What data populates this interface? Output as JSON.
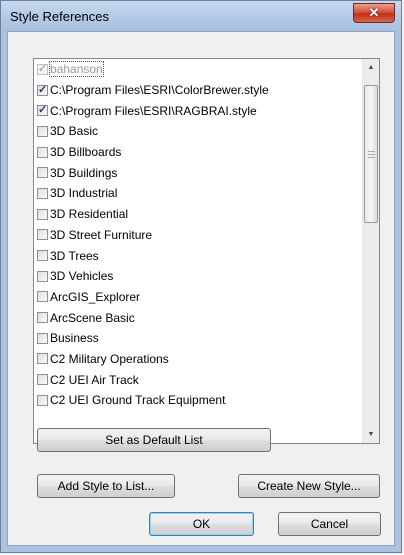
{
  "window": {
    "title": "Style References",
    "close_glyph": "✕"
  },
  "list": {
    "items": [
      {
        "label": "bahanson",
        "checked": true,
        "disabled": true
      },
      {
        "label": "C:\\Program Files\\ESRI\\ColorBrewer.style",
        "checked": true,
        "disabled": false
      },
      {
        "label": "C:\\Program Files\\ESRI\\RAGBRAI.style",
        "checked": true,
        "disabled": false
      },
      {
        "label": "3D Basic",
        "checked": false,
        "disabled": false
      },
      {
        "label": "3D Billboards",
        "checked": false,
        "disabled": false
      },
      {
        "label": "3D Buildings",
        "checked": false,
        "disabled": false
      },
      {
        "label": "3D Industrial",
        "checked": false,
        "disabled": false
      },
      {
        "label": "3D Residential",
        "checked": false,
        "disabled": false
      },
      {
        "label": "3D Street Furniture",
        "checked": false,
        "disabled": false
      },
      {
        "label": "3D Trees",
        "checked": false,
        "disabled": false
      },
      {
        "label": "3D Vehicles",
        "checked": false,
        "disabled": false
      },
      {
        "label": "ArcGIS_Explorer",
        "checked": false,
        "disabled": false
      },
      {
        "label": "ArcScene Basic",
        "checked": false,
        "disabled": false
      },
      {
        "label": "Business",
        "checked": false,
        "disabled": false
      },
      {
        "label": "C2 Military Operations",
        "checked": false,
        "disabled": false
      },
      {
        "label": "C2 UEI Air Track",
        "checked": false,
        "disabled": false
      },
      {
        "label": "C2 UEI Ground Track Equipment",
        "checked": false,
        "disabled": false
      }
    ]
  },
  "buttons": {
    "set_default": "Set as Default List",
    "add_style": "Add Style to List...",
    "create_style": "Create New Style...",
    "ok": "OK",
    "cancel": "Cancel"
  },
  "icons": {
    "scroll_up": "▲",
    "scroll_down": "▼",
    "checkmark": "✓"
  },
  "colors": {
    "title_bar": "#b5cbe6",
    "close_button": "#c23218",
    "default_button_border": "#3c7fb1",
    "list_background": "#ffffff",
    "disabled_text": "#9a9a9a"
  }
}
